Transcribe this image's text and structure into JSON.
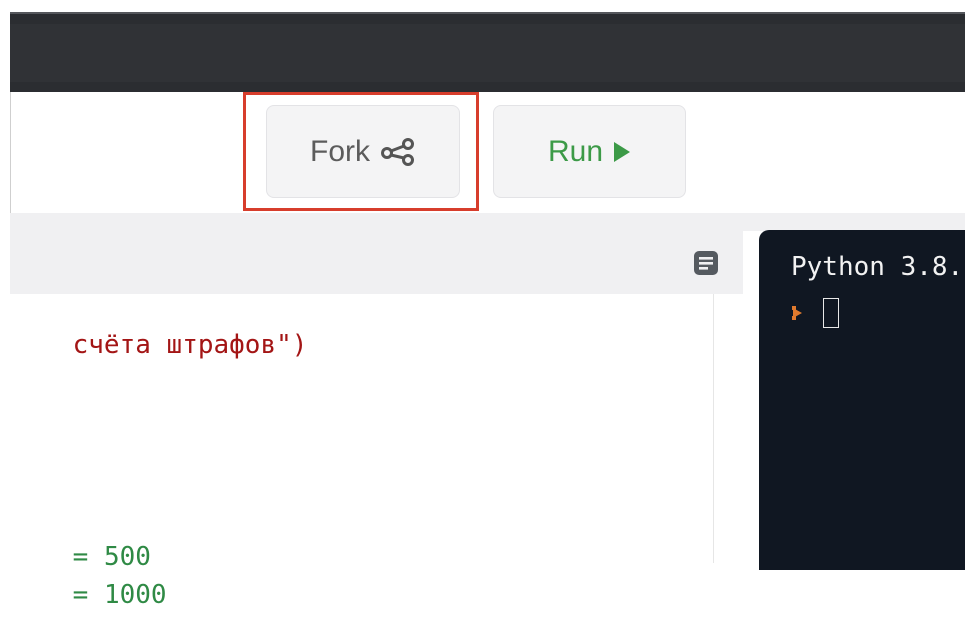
{
  "toolbar": {
    "fork_label": "Fork",
    "run_label": "Run",
    "highlight_color": "#d73d2c",
    "fork_icon": "share-icon",
    "run_icon": "play-icon"
  },
  "editor": {
    "menu_icon": "document-lines-icon",
    "lines": [
      {
        "text": "счёта штрафов",
        "suffix": "\")"
      },
      {
        "op": "= ",
        "num": "500"
      },
      {
        "op": "= ",
        "num": "1000"
      }
    ]
  },
  "console": {
    "title": "Python 3.8.",
    "prompt_icon": "chevron-right-icon"
  }
}
